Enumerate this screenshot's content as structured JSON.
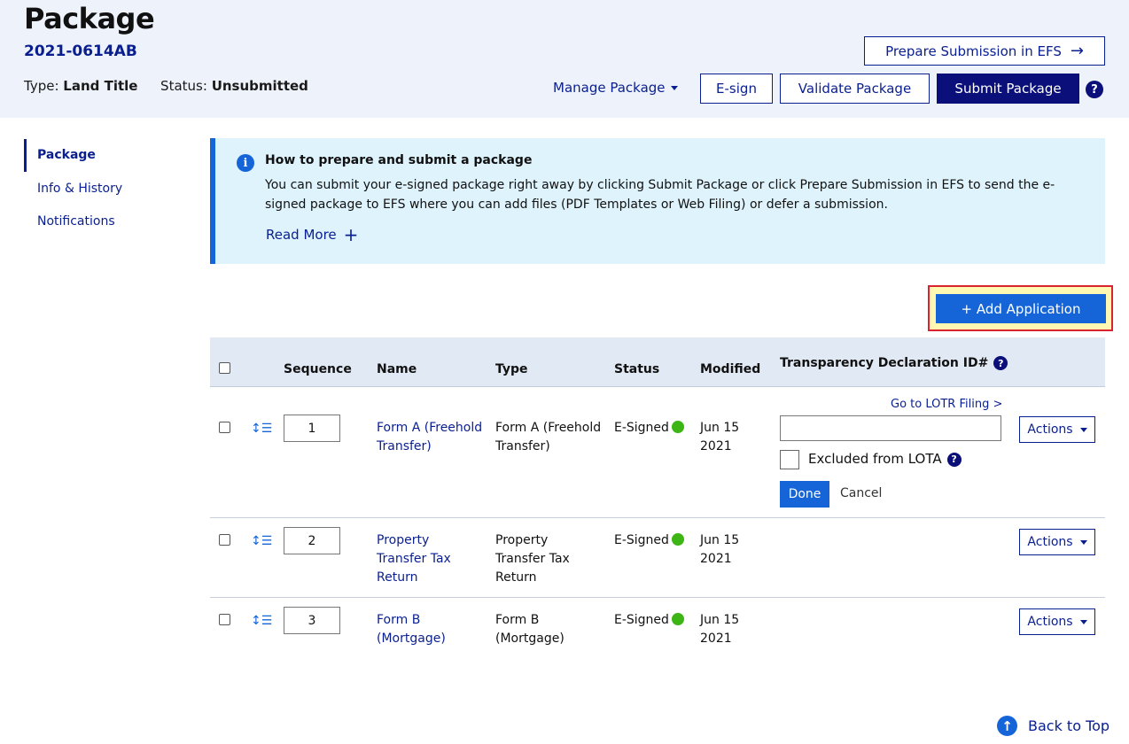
{
  "header": {
    "title": "Package",
    "package_id": "2021-0614AB",
    "type_label": "Type:",
    "type_value": "Land Title",
    "status_label": "Status:",
    "status_value": "Unsubmitted",
    "prepare_label": "Prepare Submission in EFS",
    "manage_label": "Manage Package",
    "esign_label": "E-sign",
    "validate_label": "Validate Package",
    "submit_label": "Submit Package"
  },
  "sidebar": {
    "items": [
      {
        "label": "Package",
        "active": true
      },
      {
        "label": "Info & History",
        "active": false
      },
      {
        "label": "Notifications",
        "active": false
      }
    ]
  },
  "info": {
    "title": "How to prepare and submit a package",
    "text": "You can submit your e-signed package right away by clicking Submit Package or click Prepare Submission in EFS to send the e-signed package to EFS where you can add files (PDF Templates or Web Filing) or defer a submission.",
    "read_more": "Read More"
  },
  "add_application_label": "+ Add Application",
  "table": {
    "headers": {
      "sequence": "Sequence",
      "name": "Name",
      "type": "Type",
      "status": "Status",
      "modified": "Modified",
      "td_id": "Transparency Declaration ID#"
    },
    "rows": [
      {
        "sequence": "1",
        "name_line1": "Form A (Freehold",
        "name_line2": "Transfer)",
        "name_line3": "",
        "type_line1": "Form A (Freehold",
        "type_line2": "Transfer)",
        "type_line3": "",
        "status": "E-Signed",
        "modified_line1": "Jun 15",
        "modified_line2": "2021",
        "actions": "Actions"
      },
      {
        "sequence": "2",
        "name_line1": "Property",
        "name_line2": "Transfer Tax",
        "name_line3": "Return",
        "type_line1": "Property",
        "type_line2": "Transfer Tax",
        "type_line3": "Return",
        "status": "E-Signed",
        "modified_line1": "Jun 15",
        "modified_line2": "2021",
        "actions": "Actions"
      },
      {
        "sequence": "3",
        "name_line1": "Form B",
        "name_line2": "(Mortgage)",
        "name_line3": "",
        "type_line1": "Form B",
        "type_line2": "(Mortgage)",
        "type_line3": "",
        "status": "E-Signed",
        "modified_line1": "Jun 15",
        "modified_line2": "2021",
        "actions": "Actions"
      }
    ],
    "td_edit": {
      "lotr_link": "Go to LOTR Filing >",
      "input_value": "",
      "excluded_label": "Excluded from LOTA",
      "done_label": "Done",
      "cancel_label": "Cancel"
    }
  },
  "back_to_top": "Back to Top",
  "colors": {
    "header_bg": "#eef2fa",
    "navy": "#0a0f7a",
    "link": "#0a1f8f",
    "primary": "#1565d8",
    "info_bg": "#def3fc",
    "signed_green": "#3cb515",
    "highlight_border": "#d9232e",
    "highlight_bg": "#fff8b3"
  }
}
